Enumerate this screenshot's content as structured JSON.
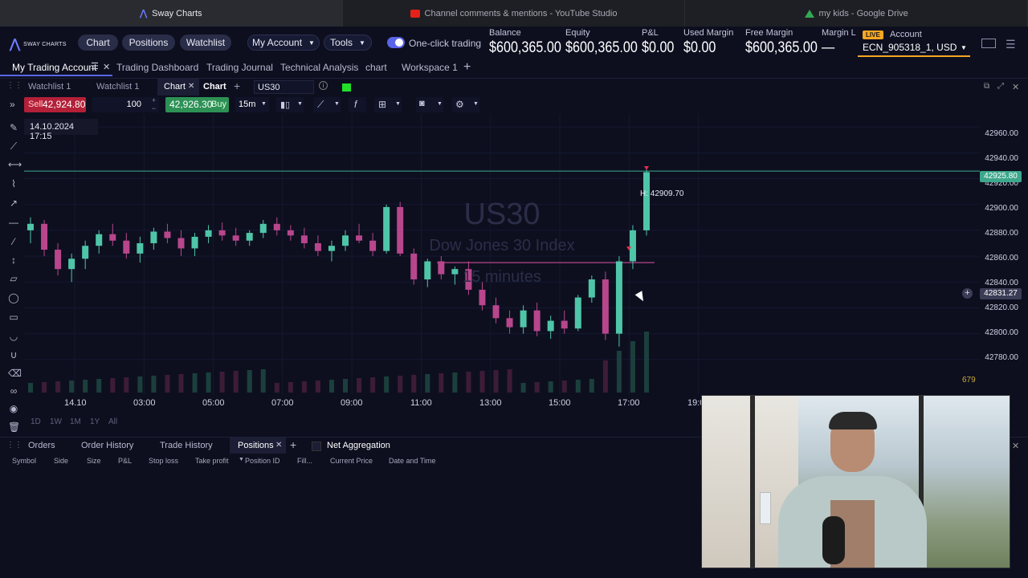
{
  "browser": {
    "tabs": [
      {
        "label": "Sway Charts",
        "active": true,
        "icon": "sway-logo-icon"
      },
      {
        "label": "Channel comments & mentions - YouTube Studio",
        "active": false,
        "icon": "youtube-icon"
      },
      {
        "label": "my kids - Google Drive",
        "active": false,
        "icon": "google-drive-icon"
      }
    ]
  },
  "header": {
    "logo_text": "SWAY CHARTS",
    "nav_buttons": [
      "Chart",
      "Positions",
      "Watchlist"
    ],
    "my_account": "My Account",
    "tools": "Tools",
    "one_click": "One-click trading",
    "metrics": [
      {
        "label": "Balance",
        "value": "$600,365.00"
      },
      {
        "label": "Equity",
        "value": "$600,365.00"
      },
      {
        "label": "P&L",
        "value": "$0.00"
      },
      {
        "label": "Used Margin",
        "value": "$0.00"
      },
      {
        "label": "Free Margin",
        "value": "$600,365.00"
      },
      {
        "label": "Margin L",
        "value": "—"
      }
    ],
    "live_badge": "LIVE",
    "account_label": "Account",
    "account_value": "ECN_905318_1, USD"
  },
  "workspace_tabs": [
    "My Trading Account",
    "Trading Dashboard",
    "Trading Journal",
    "Technical Analysis",
    "chart",
    "Workspace 1"
  ],
  "chart_tabs": {
    "tabs": [
      "Watchlist 1",
      "Watchlist 1",
      "Chart",
      "Chart"
    ],
    "symbol": "US30"
  },
  "trade_bar": {
    "sell_label": "Sell",
    "sell_price": "42,924.80",
    "quantity": "100",
    "buy_price": "42,926.30",
    "buy_label": "Buy",
    "timeframe": "15m"
  },
  "chart_overlay": {
    "datetime": "14.10.2024 17:15",
    "watermark_symbol": "US30",
    "watermark_name": "Dow Jones 30 Index",
    "watermark_tf": "15 minutes",
    "high_label": "H: 42909.70",
    "volume_label": "679",
    "current_price_tag": "42925.80",
    "cursor_price_tag": "42831.27"
  },
  "chart_data": {
    "type": "candlestick",
    "y_ticks": [
      "42960.00",
      "42940.00",
      "42920.00",
      "42900.00",
      "42880.00",
      "42860.00",
      "42840.00",
      "42820.00",
      "42800.00",
      "42780.00"
    ],
    "x_ticks": [
      "14.10",
      "03:00",
      "05:00",
      "07:00",
      "09:00",
      "11:00",
      "13:00",
      "15:00",
      "17:00",
      "19:0"
    ],
    "ylim": [
      42765,
      42970
    ],
    "current_price": 42925.8,
    "candles": [
      [
        42880,
        42890,
        42870,
        42885
      ],
      [
        42885,
        42888,
        42860,
        42865
      ],
      [
        42865,
        42870,
        42845,
        42850
      ],
      [
        42850,
        42862,
        42840,
        42858
      ],
      [
        42858,
        42872,
        42850,
        42868
      ],
      [
        42868,
        42880,
        42862,
        42877
      ],
      [
        42877,
        42885,
        42868,
        42872
      ],
      [
        42872,
        42878,
        42858,
        42862
      ],
      [
        42862,
        42875,
        42855,
        42870
      ],
      [
        42870,
        42882,
        42865,
        42879
      ],
      [
        42879,
        42885,
        42870,
        42874
      ],
      [
        42874,
        42880,
        42860,
        42866
      ],
      [
        42866,
        42878,
        42860,
        42875
      ],
      [
        42875,
        42884,
        42870,
        42880
      ],
      [
        42880,
        42886,
        42872,
        42876
      ],
      [
        42876,
        42882,
        42868,
        42872
      ],
      [
        42872,
        42880,
        42868,
        42878
      ],
      [
        42878,
        42888,
        42874,
        42885
      ],
      [
        42885,
        42890,
        42876,
        42880
      ],
      [
        42880,
        42884,
        42872,
        42876
      ],
      [
        42876,
        42882,
        42866,
        42870
      ],
      [
        42870,
        42876,
        42860,
        42864
      ],
      [
        42864,
        42872,
        42856,
        42868
      ],
      [
        42868,
        42880,
        42864,
        42876
      ],
      [
        42876,
        42885,
        42870,
        42872
      ],
      [
        42872,
        42878,
        42860,
        42864
      ],
      [
        42864,
        42900,
        42862,
        42898
      ],
      [
        42898,
        42902,
        42860,
        42862
      ],
      [
        42862,
        42866,
        42838,
        42842
      ],
      [
        42842,
        42858,
        42836,
        42856
      ],
      [
        42856,
        42860,
        42842,
        42846
      ],
      [
        42846,
        42852,
        42838,
        42850
      ],
      [
        42850,
        42856,
        42830,
        42834
      ],
      [
        42834,
        42840,
        42818,
        42822
      ],
      [
        42822,
        42828,
        42808,
        42812
      ],
      [
        42812,
        42818,
        42800,
        42805
      ],
      [
        42805,
        42822,
        42800,
        42818
      ],
      [
        42818,
        42824,
        42798,
        42802
      ],
      [
        42802,
        42814,
        42796,
        42810
      ],
      [
        42810,
        42818,
        42800,
        42804
      ],
      [
        42804,
        42830,
        42802,
        42828
      ],
      [
        42828,
        42845,
        42824,
        42842
      ],
      [
        42842,
        42848,
        42795,
        42800
      ],
      [
        42800,
        42860,
        42790,
        42856
      ],
      [
        42856,
        42884,
        42850,
        42880
      ],
      [
        42880,
        42928,
        42876,
        42925
      ]
    ]
  },
  "range_buttons": [
    "1D",
    "1W",
    "1M",
    "1Y",
    "All"
  ],
  "bottom": {
    "tabs": [
      "Orders",
      "Order History",
      "Trade History",
      "Positions",
      "Net Aggregation"
    ],
    "columns": [
      "Symbol",
      "Side",
      "Size",
      "P&L",
      "Stop loss",
      "Take profit",
      "Position ID",
      "Fill...",
      "Current Price",
      "Date and Time"
    ]
  },
  "colors": {
    "bull": "#4fc5a8",
    "bear": "#b8468c",
    "accent": "#5964e8",
    "live": "#f5a623"
  }
}
